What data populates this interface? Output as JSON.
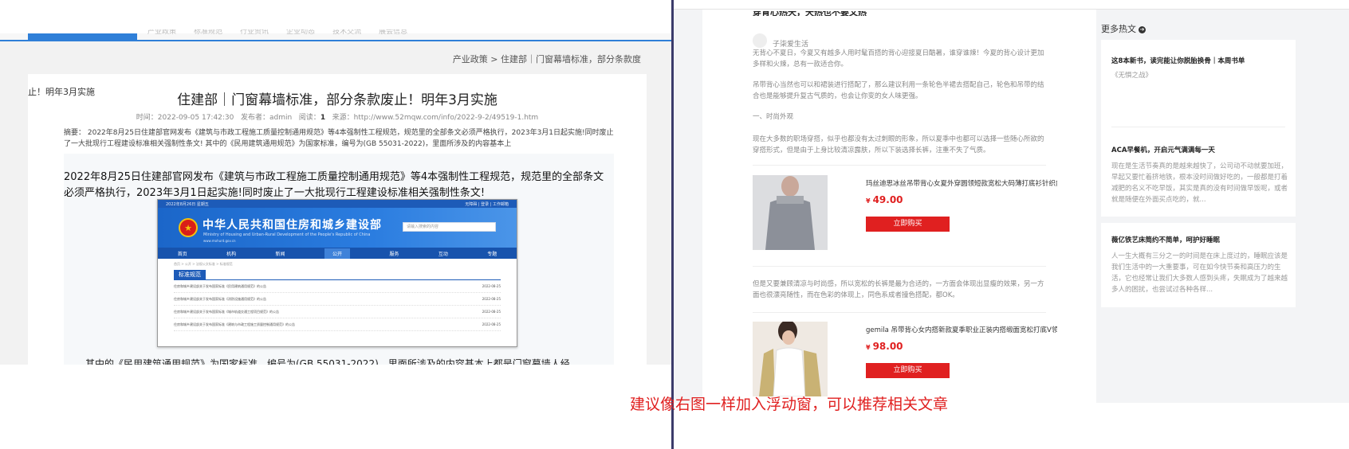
{
  "left": {
    "nav_items": [
      "产业政策",
      "标准规范",
      "行业资讯",
      "企业动态",
      "技术交流",
      "展会信息"
    ],
    "breadcrumb": "产业政策 > 住建部｜门窗幕墙标准，部分条款度",
    "side_cut_text": "止！明年3月实施",
    "article": {
      "title": "住建部｜门窗幕墙标准，部分条款废止！明年3月实施",
      "meta_time": "时间：2022-09-05 17:42:30",
      "meta_publisher_label": "发布者：",
      "meta_publisher": "admin",
      "meta_reads_label": "阅读：",
      "meta_reads": "1",
      "meta_source": "来源：http://www.52mqw.com/info/2022-9-2/49519-1.htm",
      "summary": "摘要：  2022年8月25日住建部官网发布《建筑与市政工程施工质量控制通用规范》等4本强制性工程规范，规范里的全部条文必须严格执行，2023年3月1日起实施!同时废止了一大批现行工程建设标准相关强制性条文!       其中的《民用建筑通用规范》为国家标准，编号为(GB 55031-2022)，里面所涉及的内容基本上",
      "lead": "2022年8月25日住建部官网发布《建筑与市政工程施工质量控制通用规范》等4本强制性工程规范，规范里的全部条文必须严格执行，2023年3月1日起实施!同时废止了一大批现行工程建设标准相关强制性条文!",
      "bottom_line": "其中的《民用建筑通用规范》为国家标准，编号为(GB 55031-2022)，里面所涉及的内容基本上都是门窗幕墙人经"
    },
    "embed": {
      "top_date": "2022年8月26日 星期五",
      "top_links": "无障碍 | 登录 | 工作邮箱",
      "title": "中华人民共和国住房和城乡建设部",
      "subtitle": "Ministry of Housing and Urban-Rural Development of the People's Republic of China",
      "domain": "www.mohurd.gov.cn",
      "search_placeholder": "请输入搜索的内容",
      "search_icon_glyph": "⌕",
      "nav": [
        "首页",
        "机构",
        "新闻",
        "公开",
        "服务",
        "互动",
        "专题"
      ],
      "nav_active": "公开",
      "crumb": "首页 > 公开 > 法规公文标准 > 标准规范",
      "section_label": "标准规范",
      "rows": [
        {
          "title": "住房和城乡建设部关于发布国家标准《民用建筑通用规范》的公告",
          "date": "2022-08-25"
        },
        {
          "title": "住房和城乡建设部关于发布国家标准《消防设施通用规范》的公告",
          "date": "2022-08-25"
        },
        {
          "title": "住房和城乡建设部关于发布国家标准《城市轨道交通工程项目规范》的公告",
          "date": "2022-08-25"
        },
        {
          "title": "住房和城乡建设部关于发布国家标准《建筑与市政工程施工质量控制通用规范》的公告",
          "date": "2022-08-25"
        }
      ]
    }
  },
  "right": {
    "cut_title": "穿背心热天，天热也不要又热",
    "author": "子柒爱生活",
    "paragraphs": [
      "无背心不夏日，今夏又有越多人用时髦百搭的背心迎接夏日酷暑，谁穿谁辣！今夏的背心设计更加多样和火辣，总有一款适合你。",
      "吊带背心当然也可以和裙装进行搭配了，那么建议利用一条轮色半裙去搭配自己，轮色和吊带的结合也是能够提升复古气质的，也会让你变的女人味更强。",
      "一、时尚外观",
      "现在大多数的职场穿搭，似乎也都没有太过刺眼的形象，所以夏季中也都可以选择一些随心所欲的穿搭形式，但是由于上身比较清凉露肤，所以下装选择长裤，注重不失了气质。",
      "但是又要兼顾清凉与时尚感，所以宽松的长裤是最为合适的，一方面会体现出显瘦的效果，另一方面也很漂亮随性，而在色彩的体现上，同色系成者撞色搭配，都OK。"
    ],
    "products": [
      {
        "name": "玛丝迪思冰丝吊带背心女夏外穿圆领短款宽松大码薄打底衫针织内...",
        "currency": "¥",
        "price": "49.00",
        "button": "立即购买"
      },
      {
        "name": "gemila 吊带背心女内搭新款夏季职业正装内搭缎面宽松打底V领...",
        "currency": "¥",
        "price": "98.00",
        "button": "立即购买"
      }
    ],
    "hot": {
      "heading": "更多热文",
      "arrow_glyph": "➔",
      "items": [
        {
          "title": "这8本新书，读完能让你脱胎换骨｜本周书单",
          "text": "《无惧之战》"
        },
        {
          "title": "ACA早餐机，开启元气满满每一天",
          "text": "现在是生活节奏真的是越来越快了，公司动不动就要加班，早起又要忙着挤地铁，根本没时间做好吃的，一般都是打着减肥的名义不吃早饭，其实是真的没有时间做早饭呢，或者就是随便在外面买点吃的，就..."
        },
        {
          "title": "薇亿铁艺床简约不简单，呵护好睡眠",
          "text": "人一生大概有三分之一的时间是在床上度过的，睡眠应该是我们生活中的一大重要事，可在如今快节奏和高压力的生活，它也经常让我们大多数人感到头疼，失眠成为了越来越多人的困扰，也尝试过各种各样..."
        }
      ]
    },
    "caption": "建议像右图一样加入浮动窗，可以推荐相关文章"
  },
  "colors": {
    "accent_blue": "#2f7fd8",
    "price_red": "#e02020",
    "caption_red": "#e02020"
  }
}
